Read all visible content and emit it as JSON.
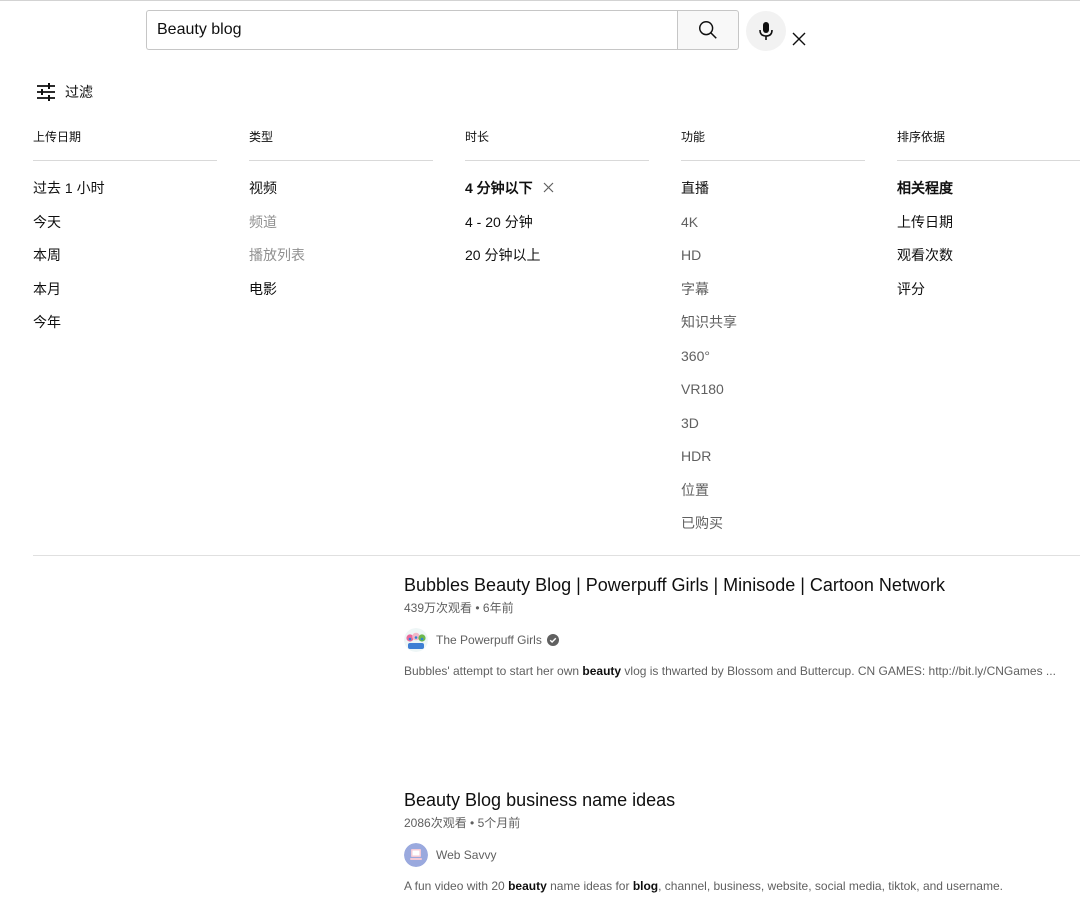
{
  "search": {
    "query": "Beauty blog"
  },
  "filters": {
    "header_label": "过滤",
    "columns": [
      {
        "title": "上传日期",
        "options": [
          {
            "label": "过去 1 小时",
            "state": "dark"
          },
          {
            "label": "今天",
            "state": "dark"
          },
          {
            "label": "本周",
            "state": "dark"
          },
          {
            "label": "本月",
            "state": "dark"
          },
          {
            "label": "今年",
            "state": "dark"
          }
        ]
      },
      {
        "title": "类型",
        "options": [
          {
            "label": "视频",
            "state": "dark"
          },
          {
            "label": "频道",
            "state": "grey"
          },
          {
            "label": "播放列表",
            "state": "grey"
          },
          {
            "label": "电影",
            "state": "dark"
          }
        ]
      },
      {
        "title": "时长",
        "options": [
          {
            "label": "4 分钟以下",
            "state": "selected"
          },
          {
            "label": "4 - 20 分钟",
            "state": "dark"
          },
          {
            "label": "20 分钟以上",
            "state": "dark"
          }
        ]
      },
      {
        "title": "功能",
        "options": [
          {
            "label": "直播",
            "state": "dark"
          },
          {
            "label": "4K",
            "state": "normal"
          },
          {
            "label": "HD",
            "state": "normal"
          },
          {
            "label": "字幕",
            "state": "normal"
          },
          {
            "label": "知识共享",
            "state": "normal"
          },
          {
            "label": "360°",
            "state": "normal"
          },
          {
            "label": "VR180",
            "state": "normal"
          },
          {
            "label": "3D",
            "state": "normal"
          },
          {
            "label": "HDR",
            "state": "normal"
          },
          {
            "label": "位置",
            "state": "normal"
          },
          {
            "label": "已购买",
            "state": "normal"
          }
        ]
      },
      {
        "title": "排序依据",
        "options": [
          {
            "label": "相关程度",
            "state": "selected"
          },
          {
            "label": "上传日期",
            "state": "dark"
          },
          {
            "label": "观看次数",
            "state": "dark"
          },
          {
            "label": "评分",
            "state": "dark"
          }
        ]
      }
    ]
  },
  "results": [
    {
      "title": "Bubbles Beauty Blog | Powerpuff Girls | Minisode | Cartoon Network",
      "views": "439万次观看",
      "age": "6年前",
      "channel": "The Powerpuff Girls",
      "verified": true,
      "avatar_icon": "powerpuff-avatar-icon",
      "description": [
        {
          "text": "Bubbles' attempt to start her own ",
          "bold": false
        },
        {
          "text": "beauty",
          "bold": true
        },
        {
          "text": " vlog is thwarted by Blossom and Buttercup. CN GAMES: http://bit.ly/CNGames ...",
          "bold": false
        }
      ]
    },
    {
      "title": "Beauty Blog business name ideas",
      "views": "2086次观看",
      "age": "5个月前",
      "channel": "Web Savvy",
      "verified": false,
      "avatar_icon": "web-savvy-avatar-icon",
      "description": [
        {
          "text": "A fun video with 20 ",
          "bold": false
        },
        {
          "text": "beauty",
          "bold": true
        },
        {
          "text": " name ideas for ",
          "bold": false
        },
        {
          "text": "blog",
          "bold": true
        },
        {
          "text": ", channel, business, website, social media, tiktok, and username.",
          "bold": false
        }
      ]
    }
  ],
  "colors": {
    "text_primary": "#0f0f0f",
    "text_secondary": "#606060",
    "text_disabled": "#909090",
    "divider": "#e0e0e0"
  }
}
